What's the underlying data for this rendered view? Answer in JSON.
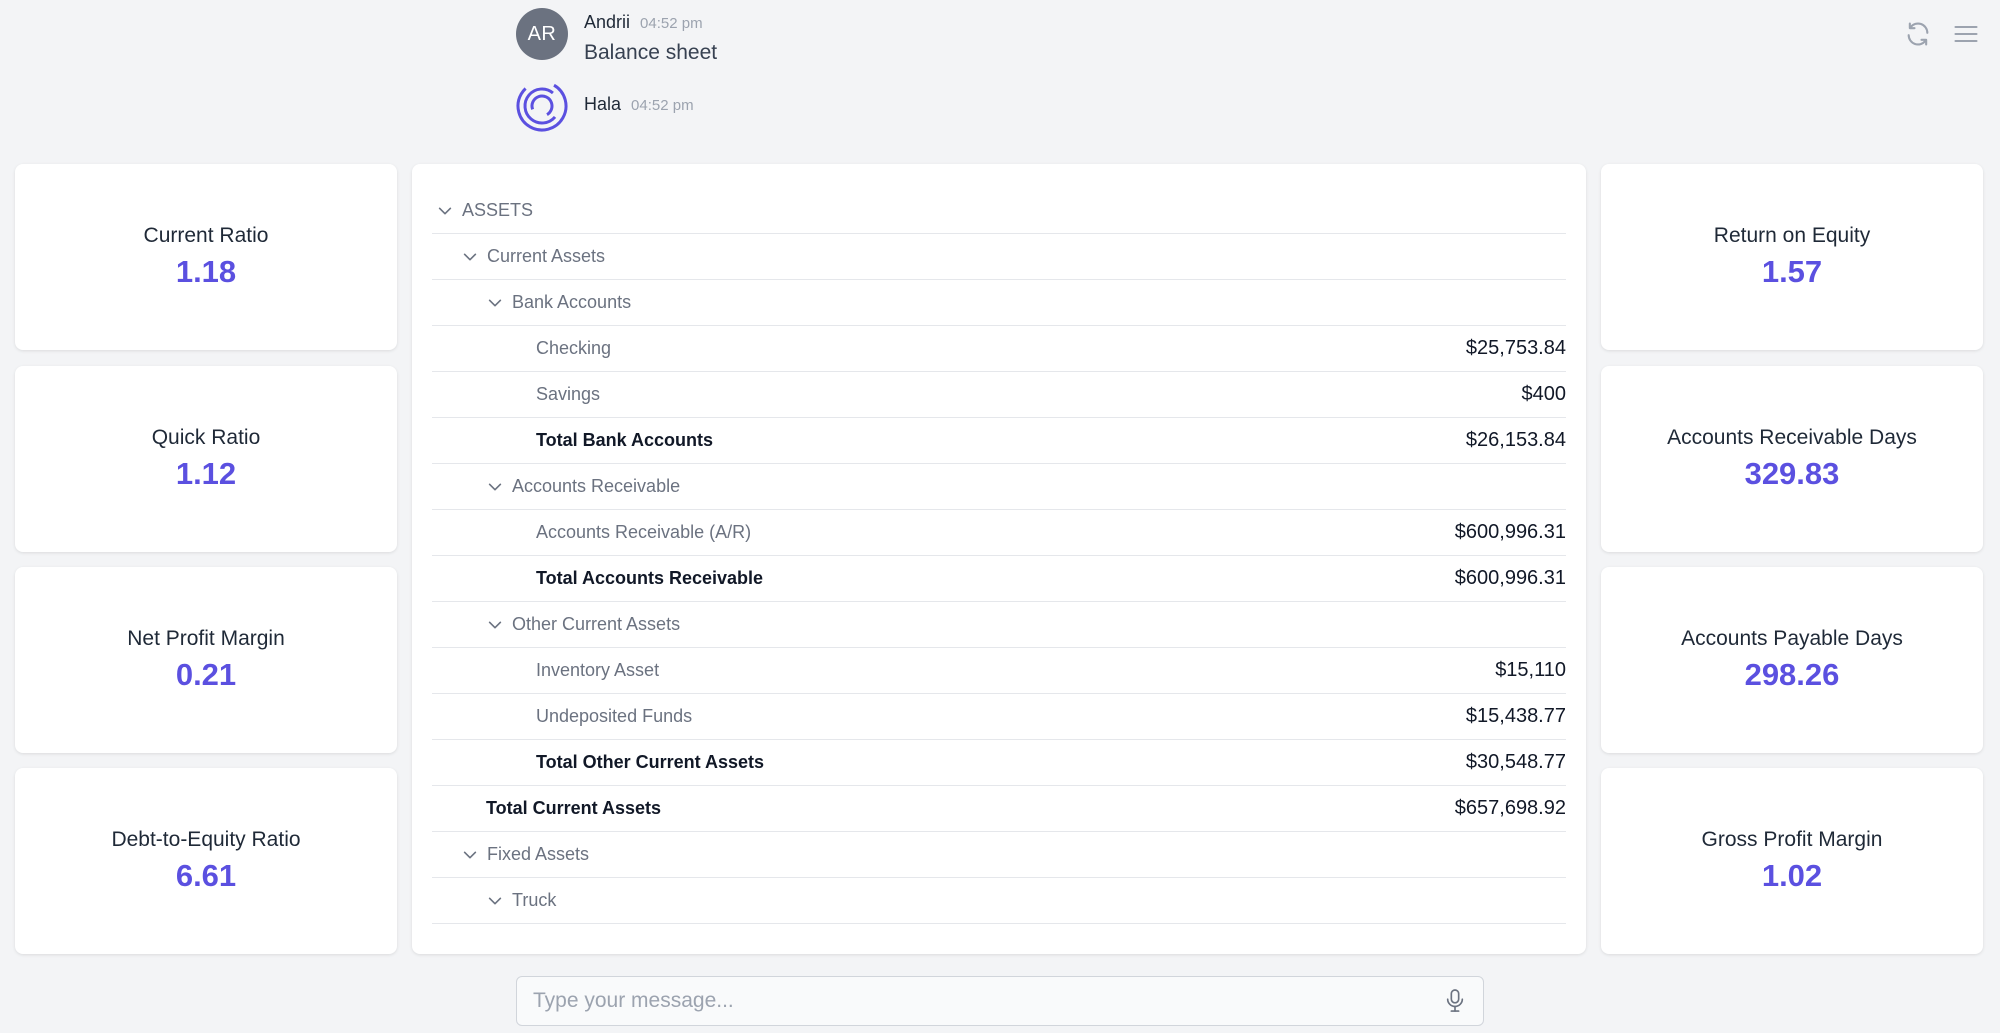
{
  "chat": {
    "messages": [
      {
        "avatar_initials": "AR",
        "author": "Andrii",
        "time": "04:52 pm",
        "text": "Balance sheet"
      },
      {
        "author": "Hala",
        "time": "04:52 pm"
      }
    ],
    "input_placeholder": "Type your message..."
  },
  "accent_color": "#5b50e0",
  "metrics_left": [
    {
      "label": "Current Ratio",
      "value": "1.18"
    },
    {
      "label": "Quick Ratio",
      "value": "1.12"
    },
    {
      "label": "Net Profit Margin",
      "value": "0.21"
    },
    {
      "label": "Debt-to-Equity Ratio",
      "value": "6.61"
    }
  ],
  "metrics_right": [
    {
      "label": "Return on Equity",
      "value": "1.57"
    },
    {
      "label": "Accounts Receivable Days",
      "value": "329.83"
    },
    {
      "label": "Accounts Payable Days",
      "value": "298.26"
    },
    {
      "label": "Gross Profit Margin",
      "value": "1.02"
    }
  ],
  "balance_sheet": [
    {
      "label": "ASSETS",
      "amount": "",
      "level": 0,
      "type": "section"
    },
    {
      "label": "Current Assets",
      "amount": "",
      "level": 1,
      "type": "section"
    },
    {
      "label": "Bank Accounts",
      "amount": "",
      "level": 2,
      "type": "section"
    },
    {
      "label": "Checking",
      "amount": "$25,753.84",
      "level": 3,
      "type": "item"
    },
    {
      "label": "Savings",
      "amount": "$400",
      "level": 3,
      "type": "item"
    },
    {
      "label": "Total Bank Accounts",
      "amount": "$26,153.84",
      "level": 3,
      "type": "total"
    },
    {
      "label": "Accounts Receivable",
      "amount": "",
      "level": 2,
      "type": "section"
    },
    {
      "label": "Accounts Receivable (A/R)",
      "amount": "$600,996.31",
      "level": 3,
      "type": "item"
    },
    {
      "label": "Total Accounts Receivable",
      "amount": "$600,996.31",
      "level": 3,
      "type": "total"
    },
    {
      "label": "Other Current Assets",
      "amount": "",
      "level": 2,
      "type": "section"
    },
    {
      "label": "Inventory Asset",
      "amount": "$15,110",
      "level": 3,
      "type": "item"
    },
    {
      "label": "Undeposited Funds",
      "amount": "$15,438.77",
      "level": 3,
      "type": "item"
    },
    {
      "label": "Total Other Current Assets",
      "amount": "$30,548.77",
      "level": 3,
      "type": "total"
    },
    {
      "label": "Total Current Assets",
      "amount": "$657,698.92",
      "level": 2,
      "type": "total"
    },
    {
      "label": "Fixed Assets",
      "amount": "",
      "level": 1,
      "type": "section"
    },
    {
      "label": "Truck",
      "amount": "",
      "level": 2,
      "type": "section"
    }
  ],
  "icons": {
    "refresh": "refresh-icon",
    "menu": "hamburger-menu-icon",
    "microphone": "microphone-icon",
    "chevron": "chevron-down-icon",
    "hala": "hala-logo-icon"
  }
}
